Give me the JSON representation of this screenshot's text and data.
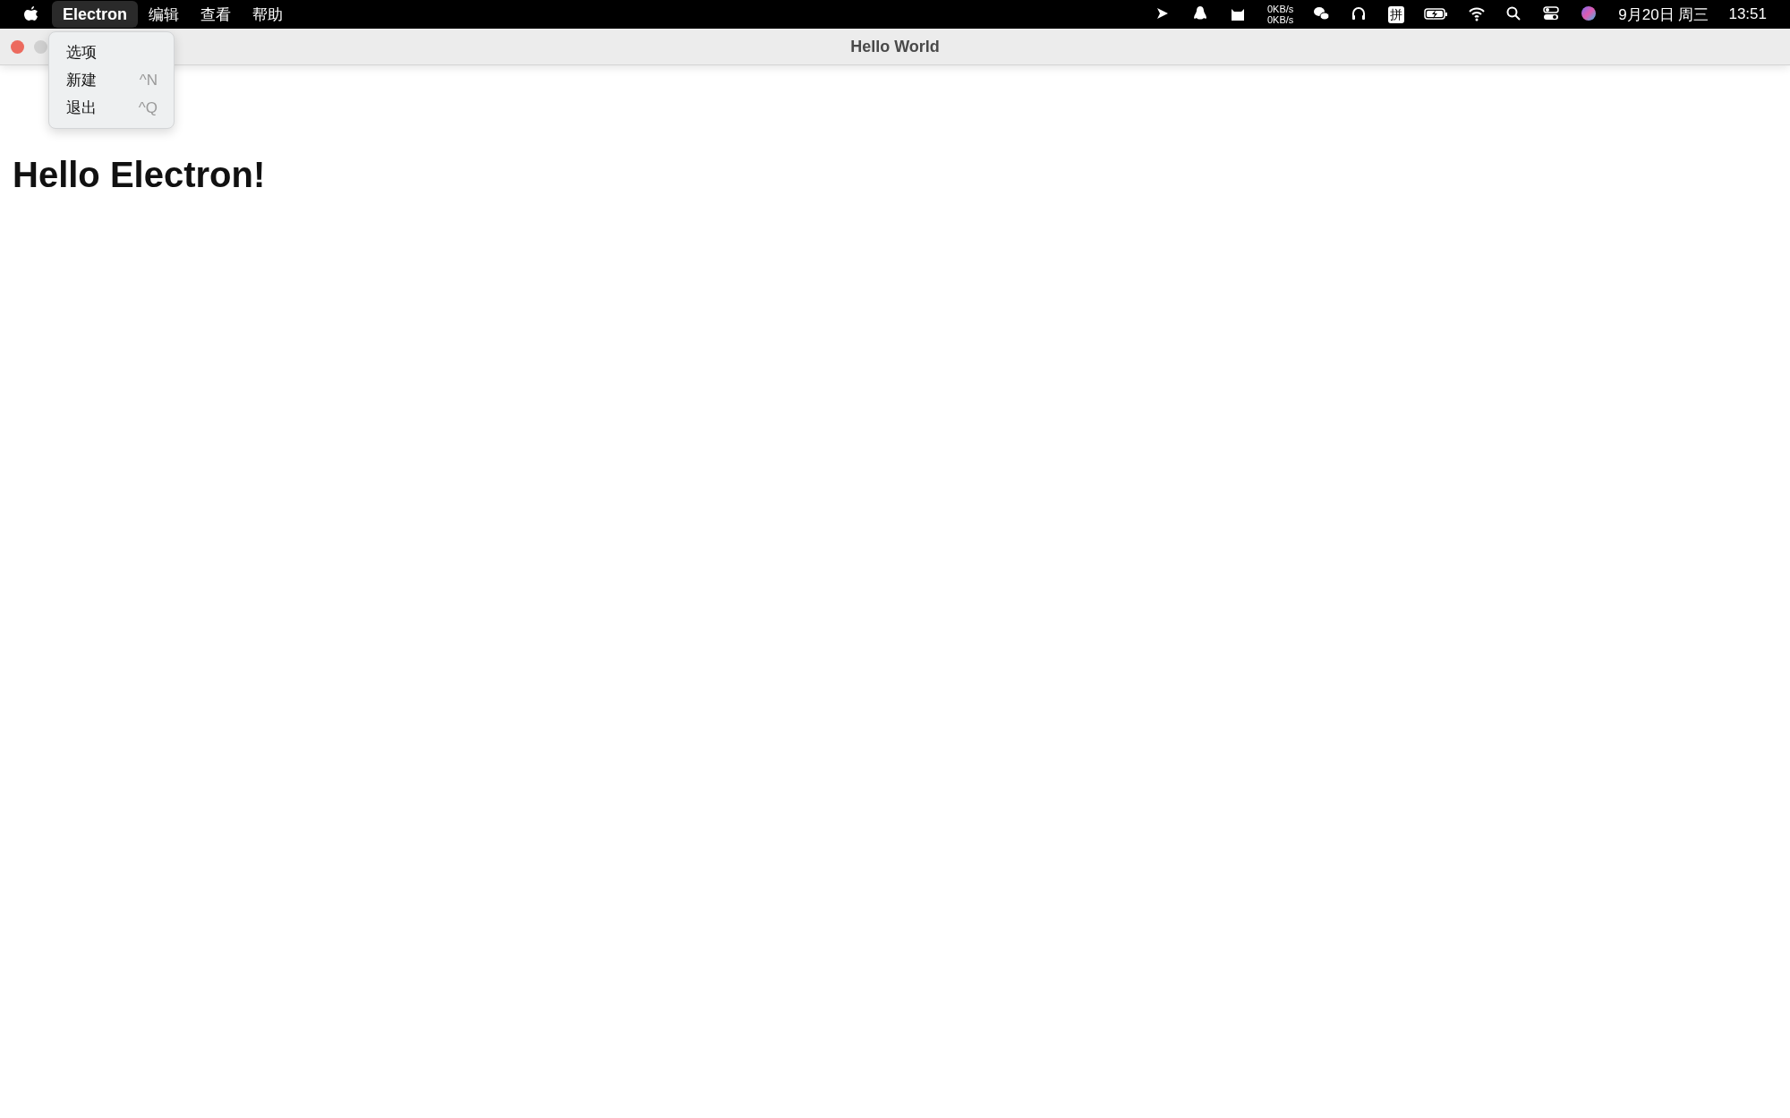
{
  "menu_bar": {
    "menus": [
      {
        "label": "Electron",
        "selected": true
      },
      {
        "label": "编辑",
        "selected": false
      },
      {
        "label": "查看",
        "selected": false
      },
      {
        "label": "帮助",
        "selected": false
      }
    ],
    "status_area": {
      "network_speed": [
        "0KB/s",
        "0KB/s"
      ],
      "input_method": "拼",
      "date": "9月20日 周三",
      "time": "13:51"
    }
  },
  "dropdown": {
    "items": [
      {
        "label": "选项"
      },
      {
        "label": "新建",
        "shortcut": "^N"
      },
      {
        "label": "退出",
        "shortcut": "^Q"
      }
    ]
  },
  "window": {
    "title": "Hello World",
    "heading": "Hello Electron!"
  }
}
